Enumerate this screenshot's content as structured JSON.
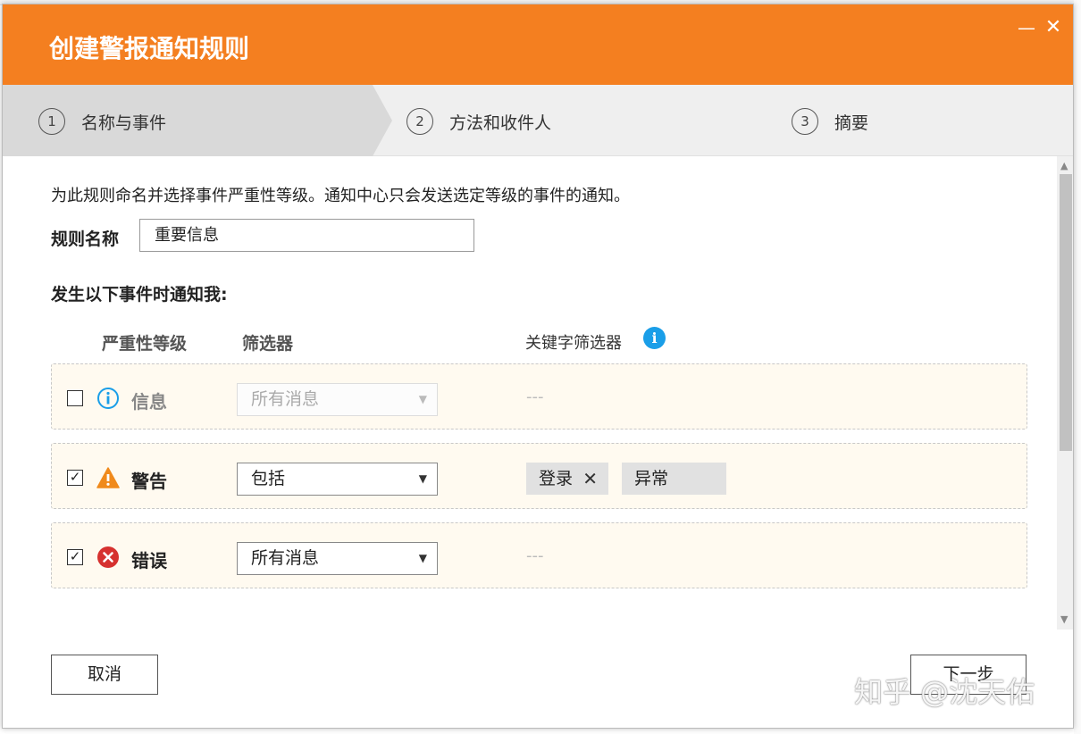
{
  "dialog": {
    "title": "创建警报通知规则",
    "minimize_glyph": "—",
    "close_glyph": "✕"
  },
  "steps": [
    {
      "num": "1",
      "label": "名称与事件"
    },
    {
      "num": "2",
      "label": "方法和收件人"
    },
    {
      "num": "3",
      "label": "摘要"
    }
  ],
  "form": {
    "description": "为此规则命名并选择事件严重性等级。通知中心只会发送选定等级的事件的通知。",
    "rule_name_label": "规则名称",
    "rule_name_value": "重要信息",
    "notify_label": "发生以下事件时通知我:",
    "col_severity": "严重性等级",
    "col_filter": "筛选器",
    "col_keyword": "关键字筛选器"
  },
  "rows": [
    {
      "checked": false,
      "icon": "info-icon",
      "severity": "信息",
      "filter": "所有消息",
      "filter_disabled": true,
      "keyword_placeholder": "---"
    },
    {
      "checked": true,
      "icon": "warning-icon",
      "severity": "警告",
      "filter": "包括",
      "filter_disabled": false,
      "keywords": [
        "登录",
        "异常"
      ]
    },
    {
      "checked": true,
      "icon": "error-icon",
      "severity": "错误",
      "filter": "所有消息",
      "filter_disabled": false,
      "keyword_placeholder": "---"
    }
  ],
  "buttons": {
    "cancel": "取消",
    "next": "下一步"
  },
  "watermark": "知乎 @沈天佑",
  "colors": {
    "accent": "#f47f20",
    "info": "#1a9ee8",
    "warning": "#f08a1c",
    "error": "#d6312f",
    "row_bg": "#fffaf0"
  }
}
